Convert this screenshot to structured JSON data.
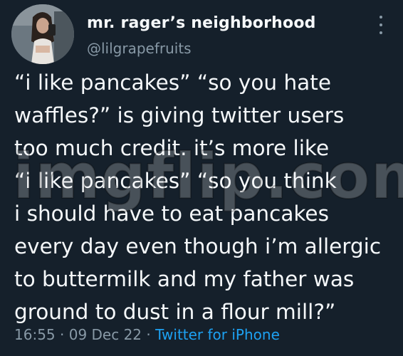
{
  "author": {
    "display_name": "mr. rager’s neighborhood",
    "handle": "@lilgrapefruits",
    "avatar_icon": "profile-photo"
  },
  "menu": {
    "icon": "more-vertical-icon"
  },
  "tweet": {
    "text": "“i like pancakes” “so you hate\nwaffles?” is giving twitter users\ntoo much credit. it’s more like\n“i like pancakes” “so you think\ni should have to eat pancakes\nevery day even though i’m allergic\nto buttermilk and my father was\nground to dust in a flour mill?”",
    "time": "16:55",
    "separator": "·",
    "date": "09 Dec 22",
    "source": "Twitter for iPhone"
  },
  "watermark": {
    "text": "imgflip.com"
  },
  "colors": {
    "background": "#15202b",
    "text": "#f5f8fa",
    "muted": "#8899a6",
    "link": "#1da1f2"
  }
}
